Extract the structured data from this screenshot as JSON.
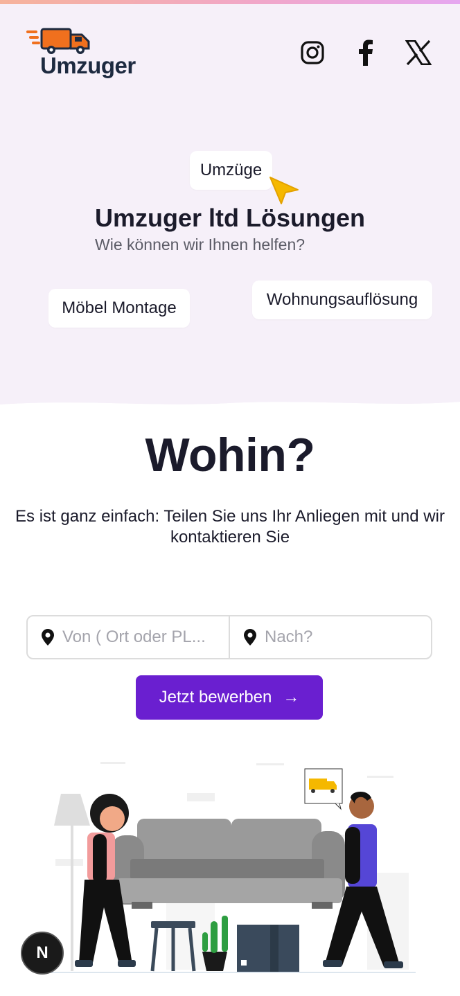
{
  "brand": {
    "name": "Umzuger",
    "accent": "#6a1fd0",
    "logo_orange": "#f0701e",
    "logo_dark": "#1d2a40"
  },
  "social": [
    {
      "name": "instagram-icon"
    },
    {
      "name": "facebook-icon"
    },
    {
      "name": "x-icon"
    }
  ],
  "hero": {
    "chips": {
      "umzuege": "Umzüge",
      "moebel": "Möbel Montage",
      "wohnung": "Wohnungsauflösung"
    },
    "title": "Umzuger ltd Lösungen",
    "subtitle": "Wie können wir Ihnen helfen?"
  },
  "main": {
    "title": "Wohin?",
    "description": "Es ist ganz einfach: Teilen Sie uns Ihr Anliegen mit und wir kontaktieren Sie"
  },
  "form": {
    "from_placeholder": "Von ( Ort oder PL...",
    "to_placeholder": "Nach?",
    "submit_label": "Jetzt bewerben",
    "submit_arrow": "→"
  },
  "badge": {
    "label": "N"
  }
}
